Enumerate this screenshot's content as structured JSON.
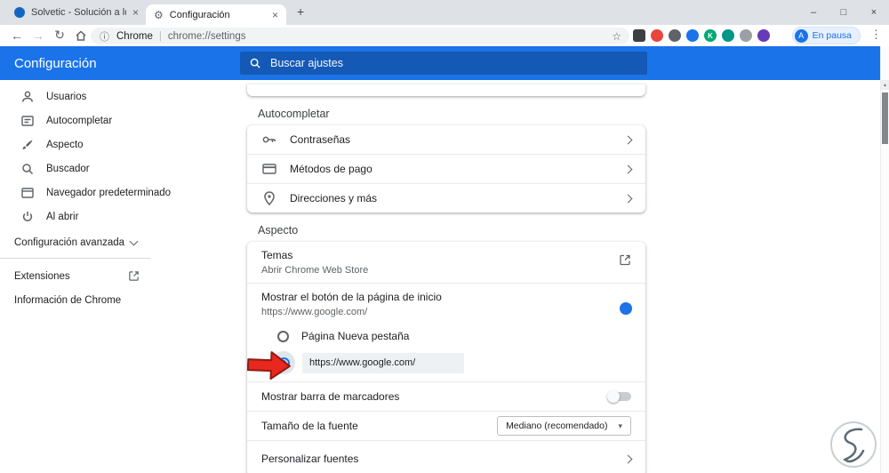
{
  "browser": {
    "tabs": [
      {
        "title": "Solvetic - Solución a los problem",
        "active": false
      },
      {
        "title": "Configuración",
        "active": true
      }
    ],
    "extensions": [
      {
        "name": "keyboard-extension-icon",
        "color": "#3c4043",
        "glyph": ""
      },
      {
        "name": "red-circle-extension-icon",
        "color": "#e8453c",
        "glyph": ""
      },
      {
        "name": "gray-extension-icon",
        "color": "#5f6368",
        "glyph": ""
      },
      {
        "name": "blue-extension-icon",
        "color": "#1a73e8",
        "glyph": ""
      },
      {
        "name": "green-k-extension-icon",
        "color": "#00a875",
        "glyph": "K"
      },
      {
        "name": "teal-brush-extension-icon",
        "color": "#009688",
        "glyph": ""
      },
      {
        "name": "person-extension-icon",
        "color": "#9aa0a6",
        "glyph": ""
      },
      {
        "name": "purple-extension-icon",
        "color": "#673ab7",
        "glyph": ""
      }
    ]
  },
  "toolbar": {
    "site_label": "Chrome",
    "separator": "|",
    "url": "chrome://settings",
    "profile": {
      "initial": "A",
      "status": "En pausa"
    }
  },
  "icons": {
    "back": "←",
    "forward": "→",
    "reload": "↻",
    "star": "☆",
    "info": "ⓘ",
    "menu": "⋮",
    "gear": "⚙",
    "new_tab": "+",
    "close": "×",
    "minimize": "–",
    "maximize": "□",
    "caret_down": "▾",
    "scroll_up": "▴"
  },
  "settings": {
    "header": {
      "title": "Configuración",
      "search_placeholder": "Buscar ajustes"
    },
    "menu": {
      "items": [
        "Usuarios",
        "Autocompletar",
        "Aspecto",
        "Buscador",
        "Navegador predeterminado",
        "Al abrir"
      ],
      "advanced": "Configuración avanzada",
      "extensions": "Extensiones",
      "about": "Información de Chrome"
    },
    "autofill": {
      "section_title": "Autocompletar",
      "rows": [
        {
          "label": "Contraseñas"
        },
        {
          "label": "Métodos de pago"
        },
        {
          "label": "Direcciones y más"
        }
      ]
    },
    "appearance": {
      "section_title": "Aspecto",
      "themes_title": "Temas",
      "themes_subtitle": "Abrir Chrome Web Store",
      "home_button_title": "Mostrar el botón de la página de inicio",
      "home_button_subtitle": "https://www.google.com/",
      "home_button_enabled": true,
      "radio_new_tab_label": "Página Nueva pestaña",
      "radio_custom_selected": true,
      "custom_url_value": "https://www.google.com/",
      "bookmarks_bar_title": "Mostrar barra de marcadores",
      "bookmarks_bar_enabled": false,
      "font_size_title": "Tamaño de la fuente",
      "font_size_value": "Mediano (recomendado)",
      "customize_fonts_title": "Personalizar fuentes"
    }
  },
  "colors": {
    "accent": "#1a73e8",
    "header_bar": "#1a73e8",
    "toggle_on": "#1a73e8",
    "annotation_arrow": "#e8281e"
  },
  "annotation": {
    "type": "red-arrow",
    "points_at": "custom-homepage-radio"
  }
}
